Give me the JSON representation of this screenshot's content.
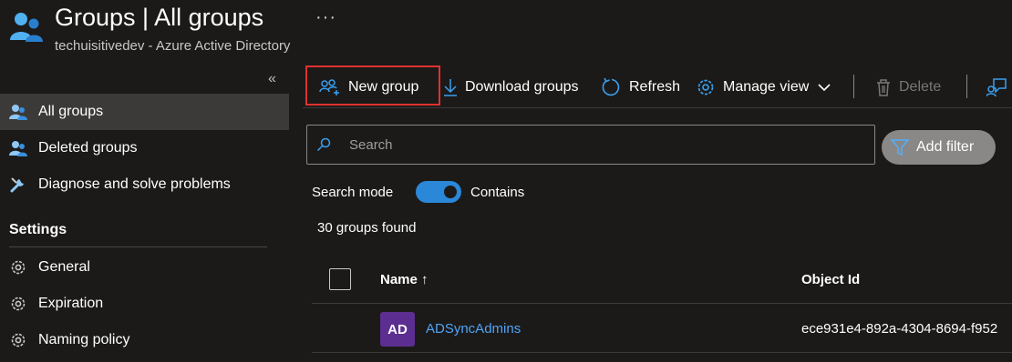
{
  "header": {
    "title": "Groups | All groups",
    "subtitle": "techuisitivedev - Azure Active Directory",
    "more_icon": "more-icon",
    "icon": "groups-icon"
  },
  "sidebar": {
    "collapse_glyph": "«",
    "items": [
      {
        "label": "All groups",
        "icon": "groups-icon",
        "selected": true
      },
      {
        "label": "Deleted groups",
        "icon": "groups-icon",
        "selected": false
      },
      {
        "label": "Diagnose and solve problems",
        "icon": "wrench-icon",
        "selected": false
      }
    ],
    "settings_heading": "Settings",
    "settings_items": [
      {
        "label": "General",
        "icon": "gear-icon"
      },
      {
        "label": "Expiration",
        "icon": "gear-icon"
      },
      {
        "label": "Naming policy",
        "icon": "gear-icon"
      }
    ]
  },
  "toolbar": {
    "new_group": "New group",
    "download_groups": "Download groups",
    "refresh": "Refresh",
    "manage_view": "Manage view",
    "delete": "Delete"
  },
  "search": {
    "placeholder": "Search",
    "value": ""
  },
  "add_filter": "Add filter",
  "search_mode": {
    "label": "Search mode",
    "toggle_on": true,
    "toggle_text": "Contains"
  },
  "results_count": "30 groups found",
  "table": {
    "columns": [
      "Name ↑",
      "Object Id"
    ],
    "rows": [
      {
        "initials": "AD",
        "name": "ADSyncAdmins",
        "object_id": "ece931e4-892a-4304-8694-f952"
      }
    ]
  },
  "colors": {
    "background": "#1b1a19",
    "accent": "#2b88d8",
    "highlight_box": "#e0312f",
    "link": "#4fa3f7",
    "avatar": "#5c2e91"
  }
}
